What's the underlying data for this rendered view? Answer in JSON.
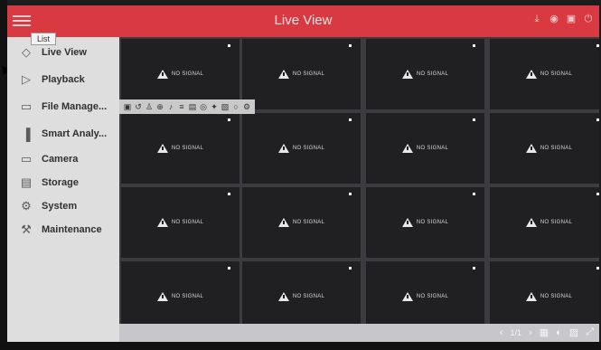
{
  "app": {
    "title": "Live View"
  },
  "tooltip": {
    "menu": "List"
  },
  "top_icons": [
    {
      "icon": "download-icon",
      "glyph": "⤓"
    },
    {
      "icon": "alert-icon",
      "glyph": "◉"
    },
    {
      "icon": "lock-icon",
      "glyph": "▣"
    },
    {
      "icon": "power-icon",
      "glyph": "⏻"
    }
  ],
  "sidebar": {
    "items": [
      {
        "label": "Live View",
        "icon": "live-view-icon",
        "glyph": "◇"
      },
      {
        "label": "Playback",
        "icon": "playback-icon",
        "glyph": "▷"
      },
      {
        "label": "File Manage...",
        "icon": "folder-icon",
        "glyph": "▭"
      },
      {
        "label": "Smart Analy...",
        "icon": "bar-chart-icon",
        "glyph": "▐"
      },
      {
        "label": "Camera",
        "icon": "camera-icon",
        "glyph": "▭"
      },
      {
        "label": "Storage",
        "icon": "storage-icon",
        "glyph": "▤"
      },
      {
        "label": "System",
        "icon": "gear-icon",
        "glyph": "⚙"
      },
      {
        "label": "Maintenance",
        "icon": "wrench-icon",
        "glyph": "⚒"
      }
    ]
  },
  "grid": {
    "no_signal_text": "NO SIGNAL",
    "channels": 16
  },
  "cell_toolbar": [
    {
      "icon": "snapshot-icon",
      "glyph": "▣"
    },
    {
      "icon": "replay-icon",
      "glyph": "↺"
    },
    {
      "icon": "person-icon",
      "glyph": "♙"
    },
    {
      "icon": "zoom-icon",
      "glyph": "⊕"
    },
    {
      "icon": "audio-icon",
      "glyph": "♪"
    },
    {
      "icon": "adjust-icon",
      "glyph": "≡"
    },
    {
      "icon": "info-icon",
      "glyph": "▤"
    },
    {
      "icon": "record-icon",
      "glyph": "◎"
    },
    {
      "icon": "ptz-icon",
      "glyph": "✦"
    },
    {
      "icon": "stream-icon",
      "glyph": "▧"
    },
    {
      "icon": "fisheye-icon",
      "glyph": "○"
    },
    {
      "icon": "settings-icon",
      "glyph": "⚙"
    }
  ],
  "pager": {
    "page": "1/1"
  },
  "bottom_icons": [
    {
      "icon": "prev-page-icon",
      "glyph": "‹"
    },
    {
      "icon": "next-page-icon",
      "glyph": "›"
    },
    {
      "icon": "layout-icon",
      "glyph": "▦"
    },
    {
      "icon": "sequence-icon",
      "glyph": "◐"
    },
    {
      "icon": "lock-screen-icon",
      "glyph": "▨"
    },
    {
      "icon": "fullscreen-icon",
      "glyph": "⤢"
    }
  ]
}
